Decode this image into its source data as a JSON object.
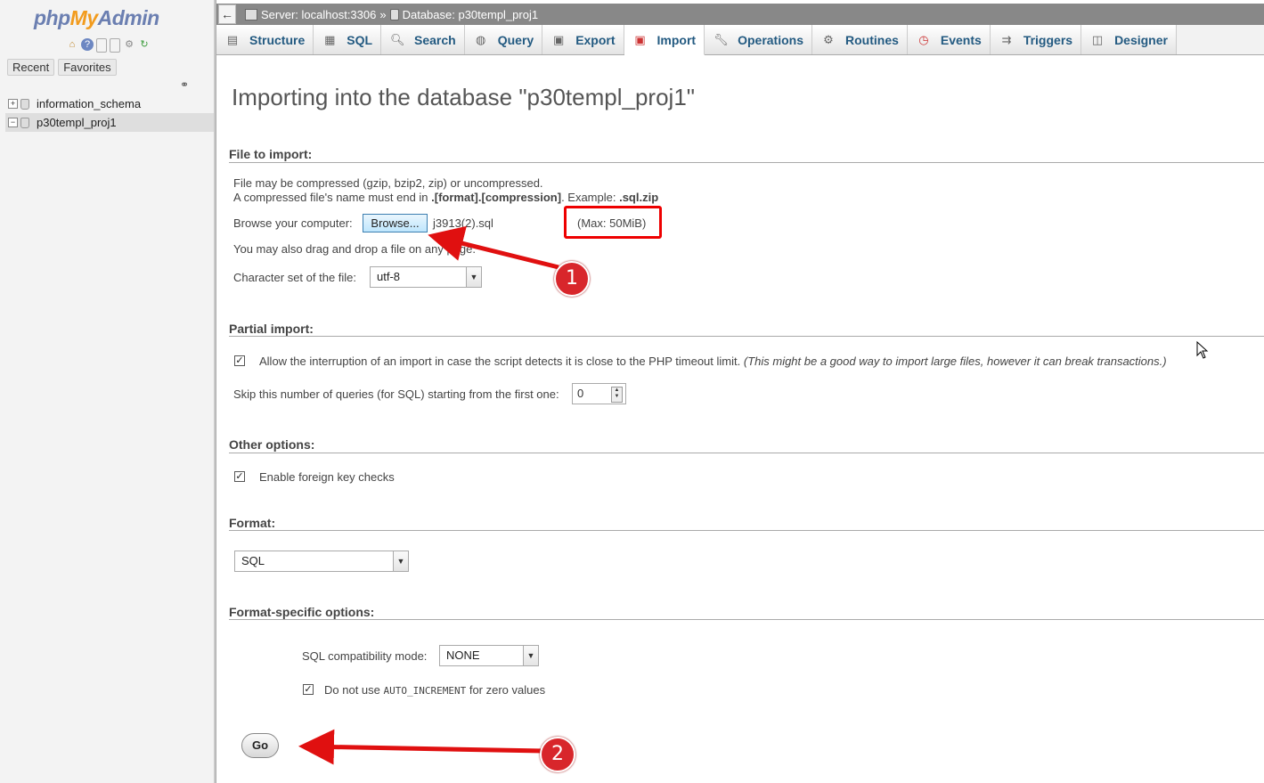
{
  "nav": {
    "logo_part1": "php",
    "logo_part2": "My",
    "logo_part3": "Admin",
    "tab_recent": "Recent",
    "tab_favorites": "Favorites",
    "databases": [
      {
        "name": "information_schema"
      },
      {
        "name": "p30templ_proj1"
      }
    ]
  },
  "topbar": {
    "back": "←",
    "server": "Server: localhost:3306",
    "sep": "»",
    "database": "Database: p30templ_proj1"
  },
  "tabs": [
    {
      "label": "Structure",
      "icon": "structure-icon"
    },
    {
      "label": "SQL",
      "icon": "sql-icon"
    },
    {
      "label": "Search",
      "icon": "search-icon"
    },
    {
      "label": "Query",
      "icon": "query-icon"
    },
    {
      "label": "Export",
      "icon": "export-icon"
    },
    {
      "label": "Import",
      "icon": "import-icon"
    },
    {
      "label": "Operations",
      "icon": "wrench-icon"
    },
    {
      "label": "Routines",
      "icon": "routines-icon"
    },
    {
      "label": "Events",
      "icon": "clock-icon"
    },
    {
      "label": "Triggers",
      "icon": "triggers-icon"
    },
    {
      "label": "Designer",
      "icon": "designer-icon"
    }
  ],
  "main": {
    "heading": "Importing into the database \"p30templ_proj1\"",
    "file_section": {
      "title": "File to import:",
      "line1": "File may be compressed (gzip, bzip2, zip) or uncompressed.",
      "line2_a": "A compressed file's name must end in ",
      "line2_b": ".[format].[compression]",
      "line2_c": ". Example: ",
      "line2_d": ".sql.zip",
      "browse_label": "Browse your computer:",
      "browse_button": "Browse...",
      "file_name": "j3913(2).sql",
      "max_size": "(Max: 50MiB)",
      "drag_note": "You may also drag and drop a file on any page.",
      "charset_label": "Character set of the file:",
      "charset_value": "utf-8"
    },
    "partial_section": {
      "title": "Partial import:",
      "allow_interrupt": "Allow the interruption of an import in case the script detects it is close to the PHP timeout limit.",
      "allow_interrupt_note": "(This might be a good way to import large files, however it can break transactions.)",
      "skip_label": "Skip this number of queries (for SQL) starting from the first one:",
      "skip_value": "0"
    },
    "other_section": {
      "title": "Other options:",
      "foreign_key": "Enable foreign key checks"
    },
    "format_section": {
      "title": "Format:",
      "format_value": "SQL"
    },
    "format_specific": {
      "title": "Format-specific options:",
      "compat_label": "SQL compatibility mode:",
      "compat_value": "NONE",
      "auto_inc_a": "Do not use ",
      "auto_inc_code": "AUTO_INCREMENT",
      "auto_inc_b": " for zero values"
    },
    "go_button": "Go"
  },
  "annotations": {
    "badge1": "1",
    "badge2": "2",
    "color": "#d8262b"
  }
}
